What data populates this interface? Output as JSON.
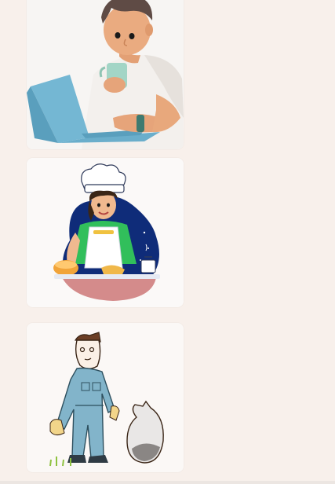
{
  "gallery": {
    "items": [
      {
        "illustration": "person-laptop-coffee-illustration",
        "bg": "#f7f5f3"
      },
      {
        "illustration": "chef-cooking-illustration",
        "bg": "#fbf9f8"
      },
      {
        "illustration": "worker-trash-bag-illustration",
        "bg": "#fbf8f6"
      }
    ]
  },
  "colors": {
    "page_bg": "#f8f0eb",
    "laptop": "#73b7d2",
    "shirt": "#f5f2ef",
    "skin": "#e9a97d",
    "mug": "#9fd2c3",
    "chef_blob": "#0e2b7a",
    "chef_shirt": "#2fbf5a",
    "worker_suit": "#7fb1c7"
  }
}
